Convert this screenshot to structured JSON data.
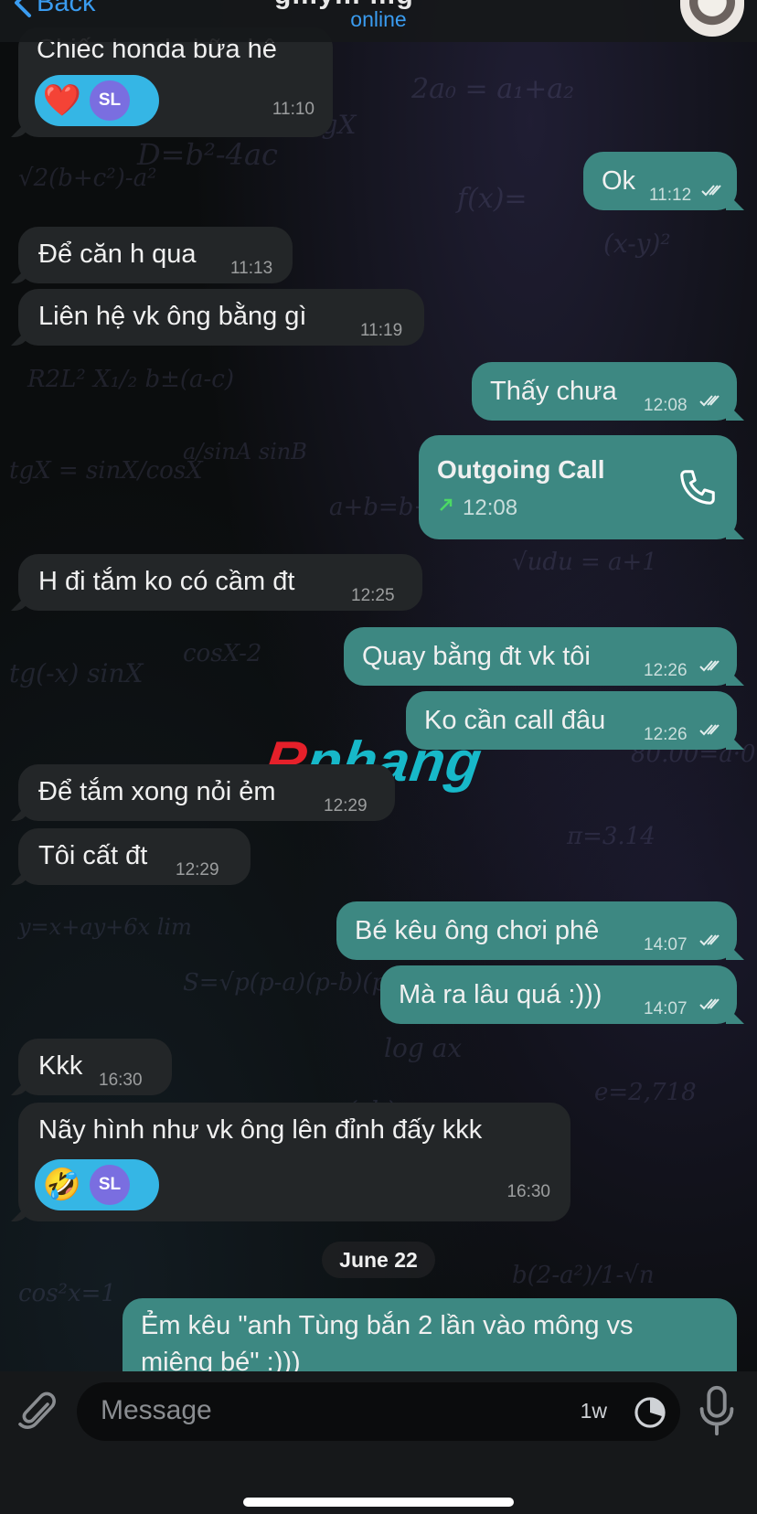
{
  "colors": {
    "accent": "#3a9cf0",
    "outgoing_bubble": "#3d8882",
    "incoming_bubble": "#232628",
    "reaction_bg": "#35b6e5",
    "call_arrow": "#4cd964"
  },
  "header": {
    "back_label": "Back",
    "title_partial": "g…y…  …g",
    "status": "online"
  },
  "messages": [
    {
      "id": "m1",
      "dir": "in",
      "text": "Chiếc honda bữa hê",
      "time": "11:10",
      "reaction": "❤️",
      "reaction_user": "SL"
    },
    {
      "id": "m2",
      "dir": "out",
      "text": "Ok",
      "time": "11:12"
    },
    {
      "id": "m3",
      "dir": "in",
      "text": "Để căn h qua",
      "time": "11:13"
    },
    {
      "id": "m4",
      "dir": "in",
      "text": "Liên hệ vk ông bằng gì",
      "time": "11:19"
    },
    {
      "id": "m5",
      "dir": "out",
      "text": "Thấy chưa",
      "time": "12:08"
    },
    {
      "id": "m6",
      "dir": "out",
      "text": "Outgoing Call",
      "time": "12:08",
      "icon": "phone-icon"
    },
    {
      "id": "m7",
      "dir": "in",
      "text": "H đi tắm ko có cầm đt",
      "time": "12:25"
    },
    {
      "id": "m8",
      "dir": "out",
      "text": "Quay bằng đt vk tôi",
      "time": "12:26"
    },
    {
      "id": "m9",
      "dir": "out",
      "text": "Ko cần call đâu",
      "time": "12:26"
    },
    {
      "id": "m10",
      "dir": "in",
      "text": "Để tắm xong nỏi ẻm",
      "time": "12:29"
    },
    {
      "id": "m11",
      "dir": "in",
      "text": "Tôi cất đt",
      "time": "12:29"
    },
    {
      "id": "m12",
      "dir": "out",
      "text": "Bé kêu ông chơi phê",
      "time": "14:07"
    },
    {
      "id": "m13",
      "dir": "out",
      "text": "Mà ra lâu quá :)))",
      "time": "14:07"
    },
    {
      "id": "m14",
      "dir": "in",
      "text": "Kkk",
      "time": "16:30"
    },
    {
      "id": "m15",
      "dir": "in",
      "text": "Nãy hình như vk ông lên đỉnh đấy kkk",
      "time": "16:30",
      "reaction": "🤣",
      "reaction_user": "SL"
    },
    {
      "id": "m16",
      "dir": "out",
      "text": "Ẻm kêu \"anh Tùng bắn 2 lần vào mông vs",
      "text_line2": "miệng bé\" :)))"
    }
  ],
  "date_separator": "June 22",
  "watermark": {
    "first": "R",
    "rest": "phang"
  },
  "composer": {
    "placeholder": "Message",
    "timer_label": "1w"
  }
}
